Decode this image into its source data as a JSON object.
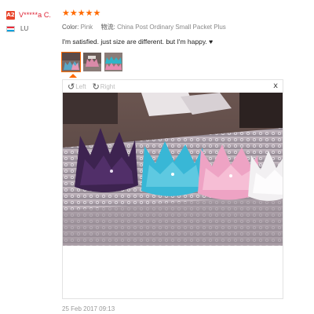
{
  "reviewer": {
    "avatar_text": "A2",
    "avatar_color": "#e8452c",
    "name": "V*****a C.",
    "country_code": "LU",
    "flag_colors": [
      "#ed2939",
      "#ffffff",
      "#00a1de"
    ]
  },
  "review": {
    "rating": 5,
    "stars": [
      "★",
      "★",
      "★",
      "★",
      "★"
    ],
    "star_color": "#ff6a00",
    "color_label": "Color:",
    "color_value": "Pink",
    "shipping_label": "物流:",
    "shipping_value": "China Post Ordinary Small Packet Plus",
    "text": "I'm satisfied. just size are different. but I'm happy. ♥",
    "date": "25 Feb 2017 09:13"
  },
  "viewer": {
    "left_icon": "rotate-left-icon",
    "left_label": "Left",
    "right_icon": "rotate-right-icon",
    "right_label": "Right",
    "close_label": "x"
  },
  "thumbnails": [
    {
      "name": "thumbnail-1",
      "active": true
    },
    {
      "name": "thumbnail-2",
      "active": false
    },
    {
      "name": "thumbnail-3",
      "active": false
    }
  ]
}
